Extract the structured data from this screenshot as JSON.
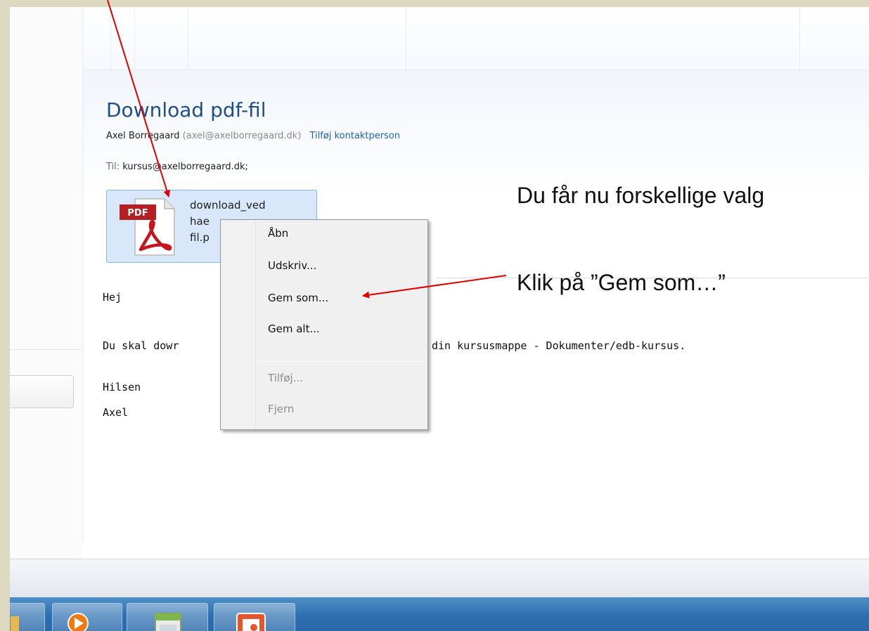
{
  "message": {
    "subject": "Download pdf-fil",
    "sender_name": "Axel Borregaard",
    "sender_email": "(axel@axelborregaard.dk)",
    "add_contact": "Tilføj kontaktperson",
    "to_label": "Til:",
    "to_value": "kursus@axelborregaard.dk;",
    "attachment": {
      "line1": "download_ved",
      "line2": "hae",
      "line3": "fil.p",
      "icon_badge": "PDF",
      "icon": "pdf-file-icon"
    },
    "body": {
      "greeting": "Hej",
      "line_left": "Du skal dowr",
      "line_right": "din kursusmappe - Dokumenter/edb-kursus.",
      "closing1": "Hilsen",
      "closing2": "Axel"
    }
  },
  "context_menu": {
    "items": [
      {
        "label": "Åbn",
        "enabled": true
      },
      {
        "label": "Udskriv...",
        "enabled": true
      },
      {
        "label": "Gem som...",
        "enabled": true
      },
      {
        "label": "Gem alt...",
        "enabled": true
      },
      {
        "label": "Tilføj...",
        "enabled": false
      },
      {
        "label": "Fjern",
        "enabled": false
      }
    ]
  },
  "annotations": {
    "line1": "Du får nu forskellige valg",
    "line2": "Klik på ”Gem som…”",
    "arrow_color": "#e00000"
  },
  "taskbar": {
    "buttons": [
      "folder-icon",
      "media-player-icon",
      "window-icon",
      "presentation-icon"
    ]
  },
  "colors": {
    "subject": "#1f4f8a",
    "link": "#1c63b7",
    "attachment_bg": "#d8e8fa",
    "taskbar": "#2d6fb0"
  }
}
